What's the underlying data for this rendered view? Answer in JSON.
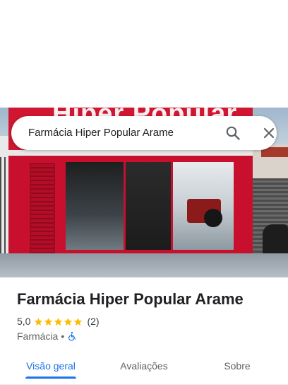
{
  "search": {
    "query": "Farmácia Hiper Popular Arame"
  },
  "place": {
    "name": "Farmácia Hiper Popular Arame",
    "rating": "5,0",
    "stars": 5,
    "review_count": "(2)",
    "category": "Farmácia",
    "separator": "•",
    "photo_sign_text": "Hiper Popular"
  },
  "tabs": [
    {
      "label": "Visão geral",
      "active": true
    },
    {
      "label": "Avaliações",
      "active": false
    },
    {
      "label": "Sobre",
      "active": false
    }
  ],
  "icons": {
    "search": "search-icon",
    "close": "close-icon",
    "star": "star-icon",
    "accessibility": "wheelchair-icon"
  },
  "colors": {
    "accent": "#1a73e8",
    "star": "#fbbc04",
    "storefront": "#c8102e"
  }
}
